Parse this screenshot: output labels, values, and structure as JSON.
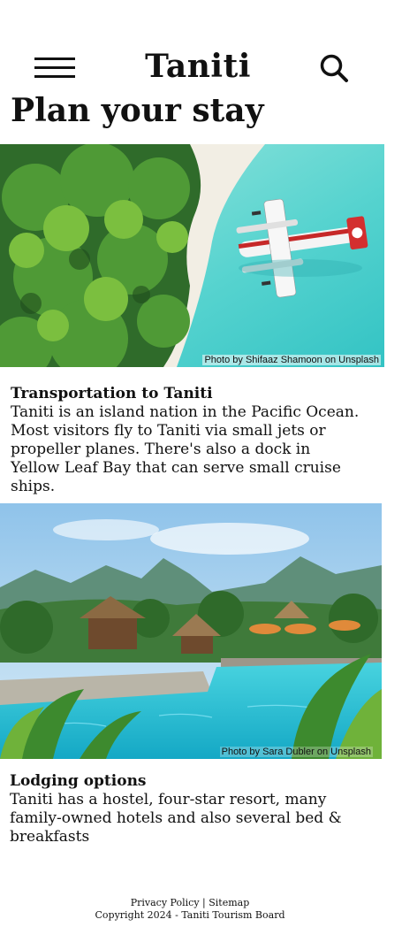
{
  "header": {
    "site_title": "Taniti",
    "menu_icon": "hamburger-menu-icon",
    "search_icon": "search-icon"
  },
  "page": {
    "title": "Plan your stay"
  },
  "sections": [
    {
      "photo_credit": "Photo by Shifaaz Shamoon on Unsplash",
      "heading": "Transportation to Taniti",
      "body": "Taniti is an island nation in the Pacific Ocean. Most visitors fly to Taniti via small jets or propeller planes. There's also a dock in Yellow Leaf Bay that can serve small cruise ships."
    },
    {
      "photo_credit": "Photo by Sara Dubler on Unsplash",
      "heading": "Lodging options",
      "body": "Taniti has a hostel, four-star resort, many family-owned hotels and also several bed & breakfasts"
    }
  ],
  "footer": {
    "privacy_link": "Privacy Policy",
    "separator": "|",
    "sitemap_link": "Sitemap",
    "copyright": "Copyright 2024 - Taniti Tourism Board"
  }
}
